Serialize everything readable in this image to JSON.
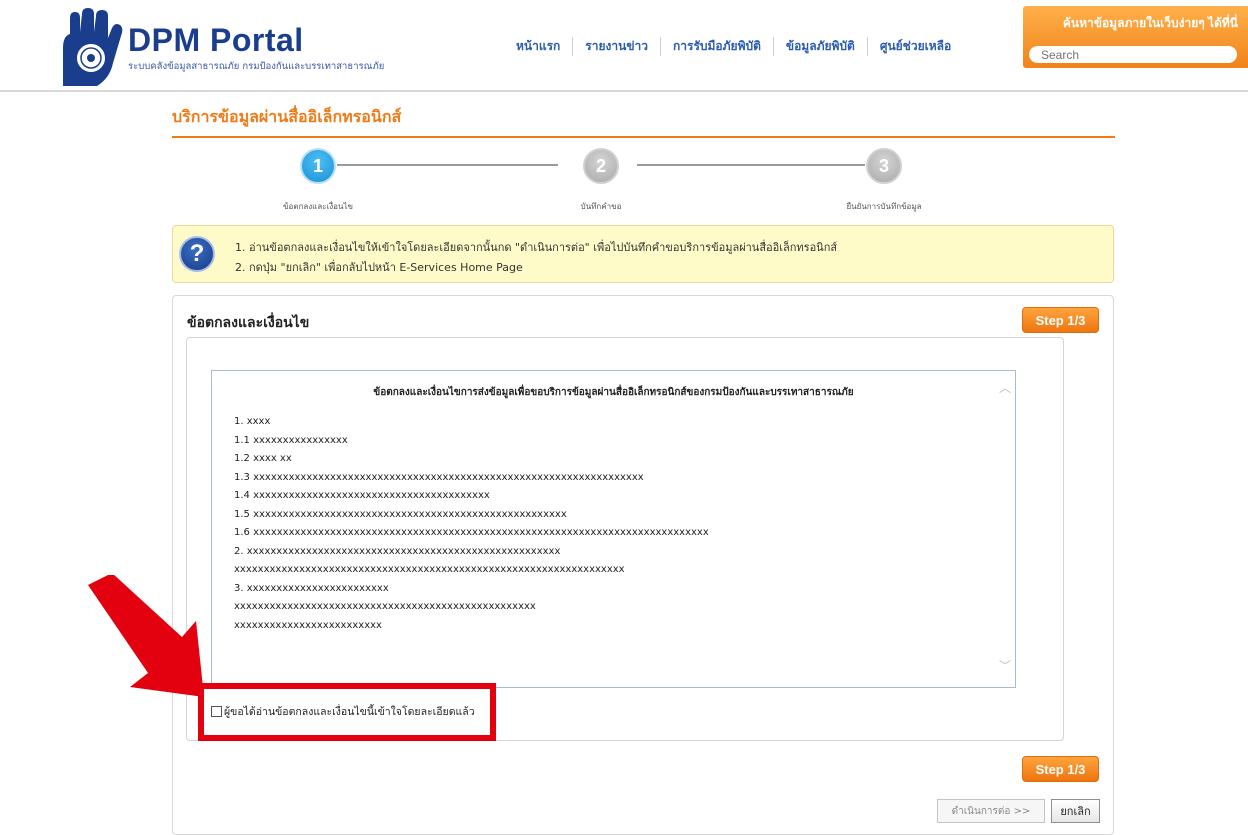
{
  "header": {
    "brand_title": "DPM Portal",
    "brand_subtitle": "ระบบคลังข้อมูลสาธารณภัย กรมป้องกันและบรรเทาสาธารณภัย",
    "nav": [
      "หน้าแรก",
      "รายงานข่าว",
      "การรับมือภัยพิบัติ",
      "ข้อมูลภัยพิบัติ",
      "ศูนย์ช่วยเหลือ"
    ],
    "search_title": "ค้นหาข้อมูลภายในเว็บง่ายๆ ได้ที่นี่",
    "search_placeholder": "Search"
  },
  "page_title": "บริการข้อมูลผ่านสื่ออิเล็กทรอนิกส์",
  "stepper": {
    "steps": [
      {
        "number": "1",
        "label": "ข้อตกลงและเงื่อนไข",
        "active": true
      },
      {
        "number": "2",
        "label": "บันทึกคำขอ",
        "active": false
      },
      {
        "number": "3",
        "label": "ยืนยันการบันทึกข้อมูล",
        "active": false
      }
    ]
  },
  "info": {
    "lines": [
      "1.  อ่านข้อตกลงและเงื่อนไขให้เข้าใจโดยละเอียดจากนั้นกด \"ดำเนินการต่อ\" เพื่อไปบันทึกคำขอบริการข้อมูลผ่านสื่ออิเล็กทรอนิกส์",
      "2.  กดปุ่ม \"ยกเลิก\" เพื่อกลับไปหน้า E-Services Home Page"
    ]
  },
  "panel": {
    "title": "ข้อตกลงและเงื่อนไข",
    "step_badge": "Step 1/3",
    "terms_heading": "ข้อตกลงและเงื่อนไขการส่งข้อมูลเพื่อขอบริการข้อมูลผ่านสื่ออิเล็กทรอนิกส์ของกรมป้องกันและบรรเทาสาธารณภัย",
    "terms_lines": [
      "1. xxxx",
      "1.1 xxxxxxxxxxxxxxxx",
      "1.2 xxxx xx",
      "1.3 xxxxxxxxxxxxxxxxxxxxxxxxxxxxxxxxxxxxxxxxxxxxxxxxxxxxxxxxxxxxxxxxxx",
      "1.4 xxxxxxxxxxxxxxxxxxxxxxxxxxxxxxxxxxxxxxxx",
      "1.5 xxxxxxxxxxxxxxxxxxxxxxxxxxxxxxxxxxxxxxxxxxxxxxxxxxxxx",
      "1.6 xxxxxxxxxxxxxxxxxxxxxxxxxxxxxxxxxxxxxxxxxxxxxxxxxxxxxxxxxxxxxxxxxxxxxxxxxxxxx",
      "2. xxxxxxxxxxxxxxxxxxxxxxxxxxxxxxxxxxxxxxxxxxxxxxxxxxxxx",
      "xxxxxxxxxxxxxxxxxxxxxxxxxxxxxxxxxxxxxxxxxxxxxxxxxxxxxxxxxxxxxxxxxx",
      "3. xxxxxxxxxxxxxxxxxxxxxxxx",
      "xxxxxxxxxxxxxxxxxxxxxxxxxxxxxxxxxxxxxxxxxxxxxxxxxxx",
      "xxxxxxxxxxxxxxxxxxxxxxxxx"
    ],
    "agree_label": "ผู้ขอได้อ่านข้อตกลงและเงื่อนไขนี้เข้าใจโดยละเอียดแล้ว",
    "agree_checked": false,
    "bottom_badge": "Step 1/3",
    "next_button": "ดำเนินการต่อ >>",
    "cancel_button": "ยกเลิก"
  },
  "colors": {
    "accent_orange": "#ee7b16",
    "brand_blue": "#1a3e8c",
    "highlight_red": "#e3000f",
    "step_active": "#1990d8"
  }
}
